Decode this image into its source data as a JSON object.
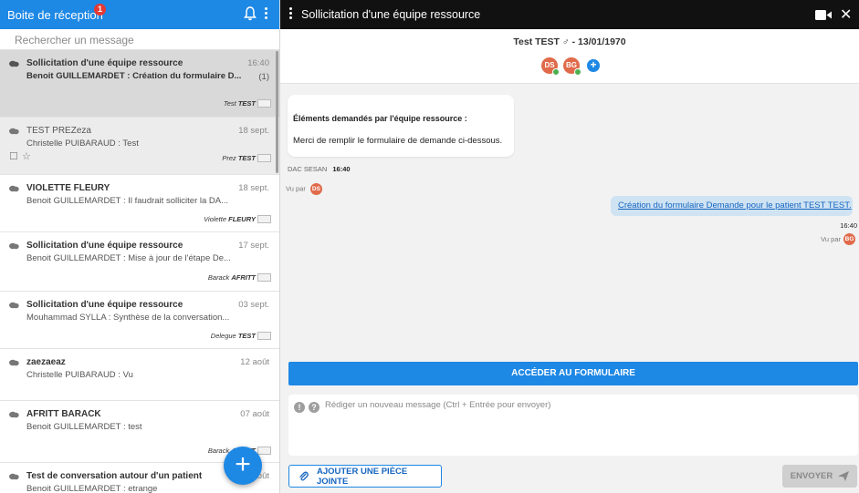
{
  "inbox": {
    "title": "Boite de réception",
    "badge": "1",
    "search_placeholder": "Rechercher un message",
    "conversations": [
      {
        "subject": "Sollicitation d'une équipe ressource",
        "preview": "Benoit GUILLEMARDET : Création du formulaire D...",
        "date": "16:40",
        "count": "(1)",
        "tag_first": "Test",
        "tag_last": "TEST"
      },
      {
        "subject": "TEST PREZeza",
        "preview": "Christelle PUIBARAUD : Test",
        "date": "18 sept.",
        "tag_first": "Prez",
        "tag_last": "TEST"
      },
      {
        "subject": "VIOLETTE FLEURY",
        "preview": "Benoit GUILLEMARDET : Il faudrait solliciter la DA...",
        "date": "18 sept.",
        "tag_first": "Violette",
        "tag_last": "FLEURY"
      },
      {
        "subject": "Sollicitation d'une équipe ressource",
        "preview": "Benoit GUILLEMARDET : Mise à jour de l'étape De...",
        "date": "17 sept.",
        "tag_first": "Barack",
        "tag_last": "AFRITT"
      },
      {
        "subject": "Sollicitation d'une équipe ressource",
        "preview": "Mouhammad SYLLA : Synthèse de la conversation...",
        "date": "03 sept.",
        "tag_first": "Delegue",
        "tag_last": "TEST"
      },
      {
        "subject": "zaezaeaz",
        "preview": "Christelle PUIBARAUD : Vu",
        "date": "12 août"
      },
      {
        "subject": "AFRITT BARACK",
        "preview": "Benoit GUILLEMARDET : test",
        "date": "07 août",
        "tag_first": "Barack",
        "tag_last": "AFRITT"
      },
      {
        "subject": "Test de conversation autour d'un patient",
        "preview": "Benoit GUILLEMARDET : etrange",
        "date": "août"
      }
    ]
  },
  "conversation": {
    "title": "Sollicitation d'une équipe ressource",
    "patient": "Test TEST ♂ - 13/01/1970",
    "participants": [
      "DS",
      "BG"
    ],
    "incoming": {
      "heading": "Éléments demandés par l'équipe ressource :",
      "body": "Merci de remplir le formulaire de demande ci-dessous.",
      "sender": "DAC SESAN",
      "time": "16:40",
      "seen_label": "Vu par",
      "seen_by": "DS"
    },
    "outgoing": {
      "link": "Création du formulaire Demande pour le patient TEST TEST.",
      "time": "16:40",
      "seen_label": "Vu par",
      "seen_by": "BG"
    },
    "open_form_label": "ACCÉDER AU FORMULAIRE",
    "compose_placeholder": "Rédiger un nouveau message (Ctrl + Entrée pour envoyer)",
    "attach_label": "AJOUTER UNE PIÈCE JOINTE",
    "send_label": "ENVOYER"
  },
  "colors": {
    "accent": "#1e88e5",
    "header_dark": "#111111",
    "avatar": "#e06a4a",
    "online": "#4caf50",
    "badge": "#e53935"
  }
}
